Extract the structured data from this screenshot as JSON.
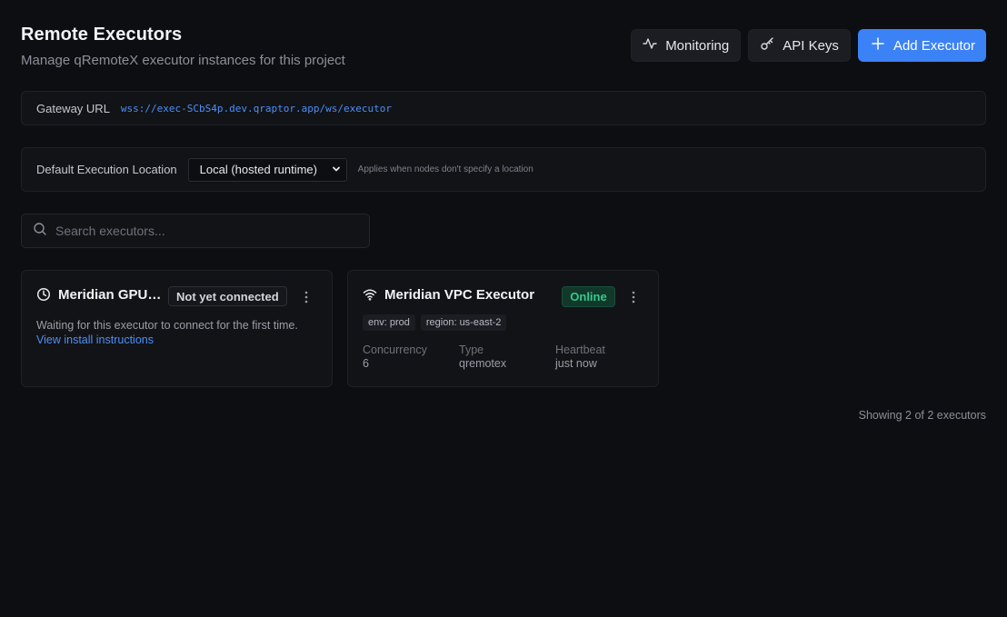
{
  "header": {
    "title": "Remote Executors",
    "subtitle": "Manage qRemoteX executor instances for this project",
    "buttons": {
      "monitoring": "Monitoring",
      "api_keys": "API Keys",
      "add_executor": "Add Executor"
    }
  },
  "gateway": {
    "label": "Gateway URL",
    "url": "wss://exec-SCbS4p.dev.qraptor.app/ws/executor"
  },
  "execution_location": {
    "label": "Default Execution Location",
    "selected": "Local (hosted runtime)",
    "hint": "Applies when nodes don't specify a location"
  },
  "search": {
    "placeholder": "Search executors..."
  },
  "executors": [
    {
      "name": "Meridian GPU Executor",
      "status": "Not yet connected",
      "icon": "clock-icon",
      "description": "Waiting for this executor to connect for the first time.",
      "link_text": "View install instructions"
    },
    {
      "name": "Meridian VPC Executor",
      "status": "Online",
      "icon": "wifi-icon",
      "tags": [
        "env: prod",
        "region: us-east-2"
      ],
      "stats": [
        {
          "label": "Concurrency",
          "value": "6"
        },
        {
          "label": "Type",
          "value": "qremotex"
        },
        {
          "label": "Heartbeat",
          "value": "just now"
        }
      ]
    }
  ],
  "footer": {
    "count_text": "Showing 2 of 2 executors"
  },
  "colors": {
    "background": "#0d0e12",
    "panel": "#121317",
    "accent": "#3b82f6",
    "link": "#4d8ff7",
    "online": "#35c98b"
  }
}
